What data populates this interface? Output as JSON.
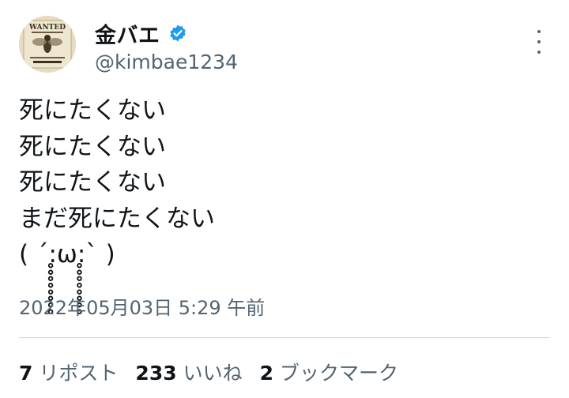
{
  "author": {
    "display_name": "金バエ",
    "handle": "@kimbae1234",
    "verified": true,
    "avatar": "wanted-poster-fly-avatar"
  },
  "tweet": {
    "lines": [
      "死にたくない",
      "死にたくない",
      "死にたくない",
      "まだ死にたくない",
      "( ´:̥̥̥̥̥̥̥̥ω:̥̥̥̥̥̥̥̥` )"
    ],
    "timestamp": "2022年05月03日 5:29 午前"
  },
  "stats": [
    {
      "count": "7",
      "label": "リポスト"
    },
    {
      "count": "233",
      "label": "いいね"
    },
    {
      "count": "2",
      "label": "ブックマーク"
    }
  ],
  "icons": {
    "verified": "verified-badge-icon",
    "more": "more-options-icon"
  },
  "colors": {
    "text": "#0f1419",
    "secondary": "#536471",
    "verified": "#1d9bf0",
    "divider": "#cfd9de"
  }
}
